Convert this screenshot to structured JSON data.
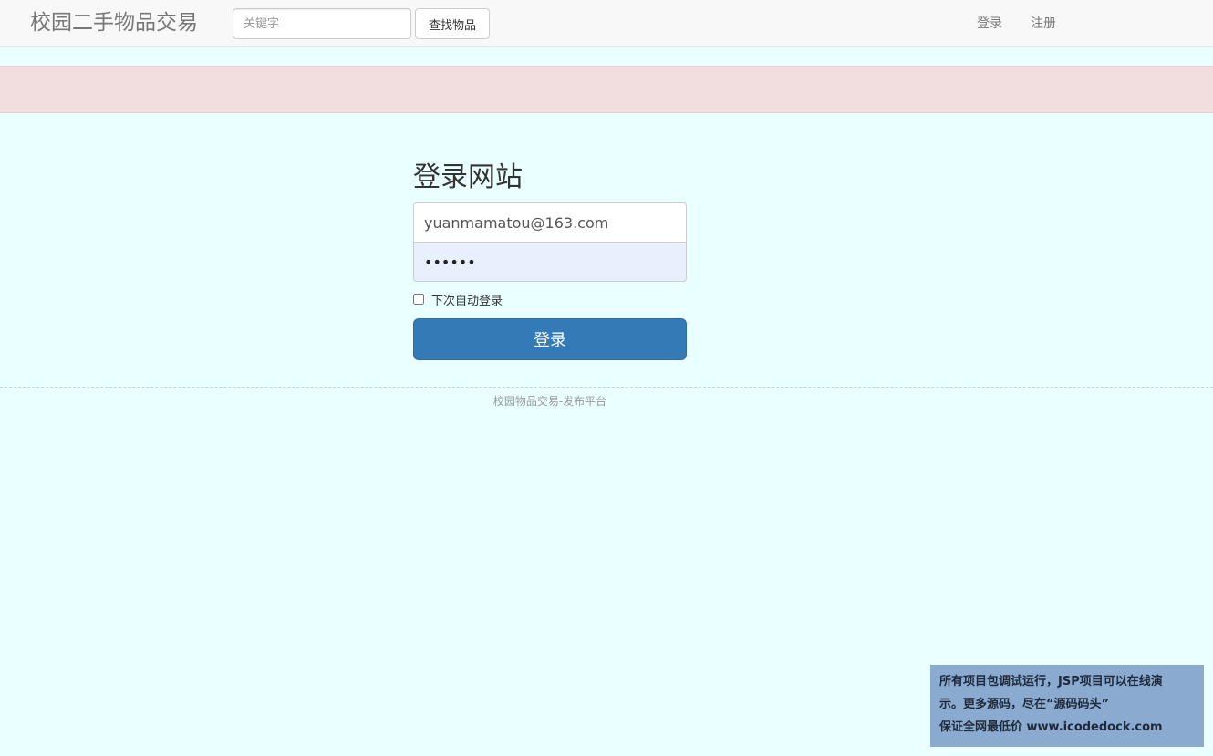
{
  "navbar": {
    "brand": "校园二手物品交易",
    "search": {
      "placeholder": "关键字",
      "value": ""
    },
    "search_button_label": "查找物品",
    "links": {
      "login": "登录",
      "register": "注册"
    }
  },
  "login_form": {
    "heading": "登录网站",
    "email_value": "yuanmamatou@163.com",
    "password_value": "123456",
    "remember_label": "下次自动登录",
    "remember_checked": false,
    "submit_label": "登录"
  },
  "footer": {
    "text": "校园物品交易-发布平台"
  },
  "watermark": {
    "line1": "所有项目包调试运行，JSP项目可以在线演",
    "line2": "示。更多源码，尽在“源码码头”",
    "line3": "保证全网最低价 www.icodedock.com"
  },
  "colors": {
    "page_background": "#eaffff",
    "alert_background": "#f2dede",
    "primary_button": "#337ab7",
    "autofill_background": "#e8f0fe",
    "watermark_background": "#8aaad0"
  }
}
